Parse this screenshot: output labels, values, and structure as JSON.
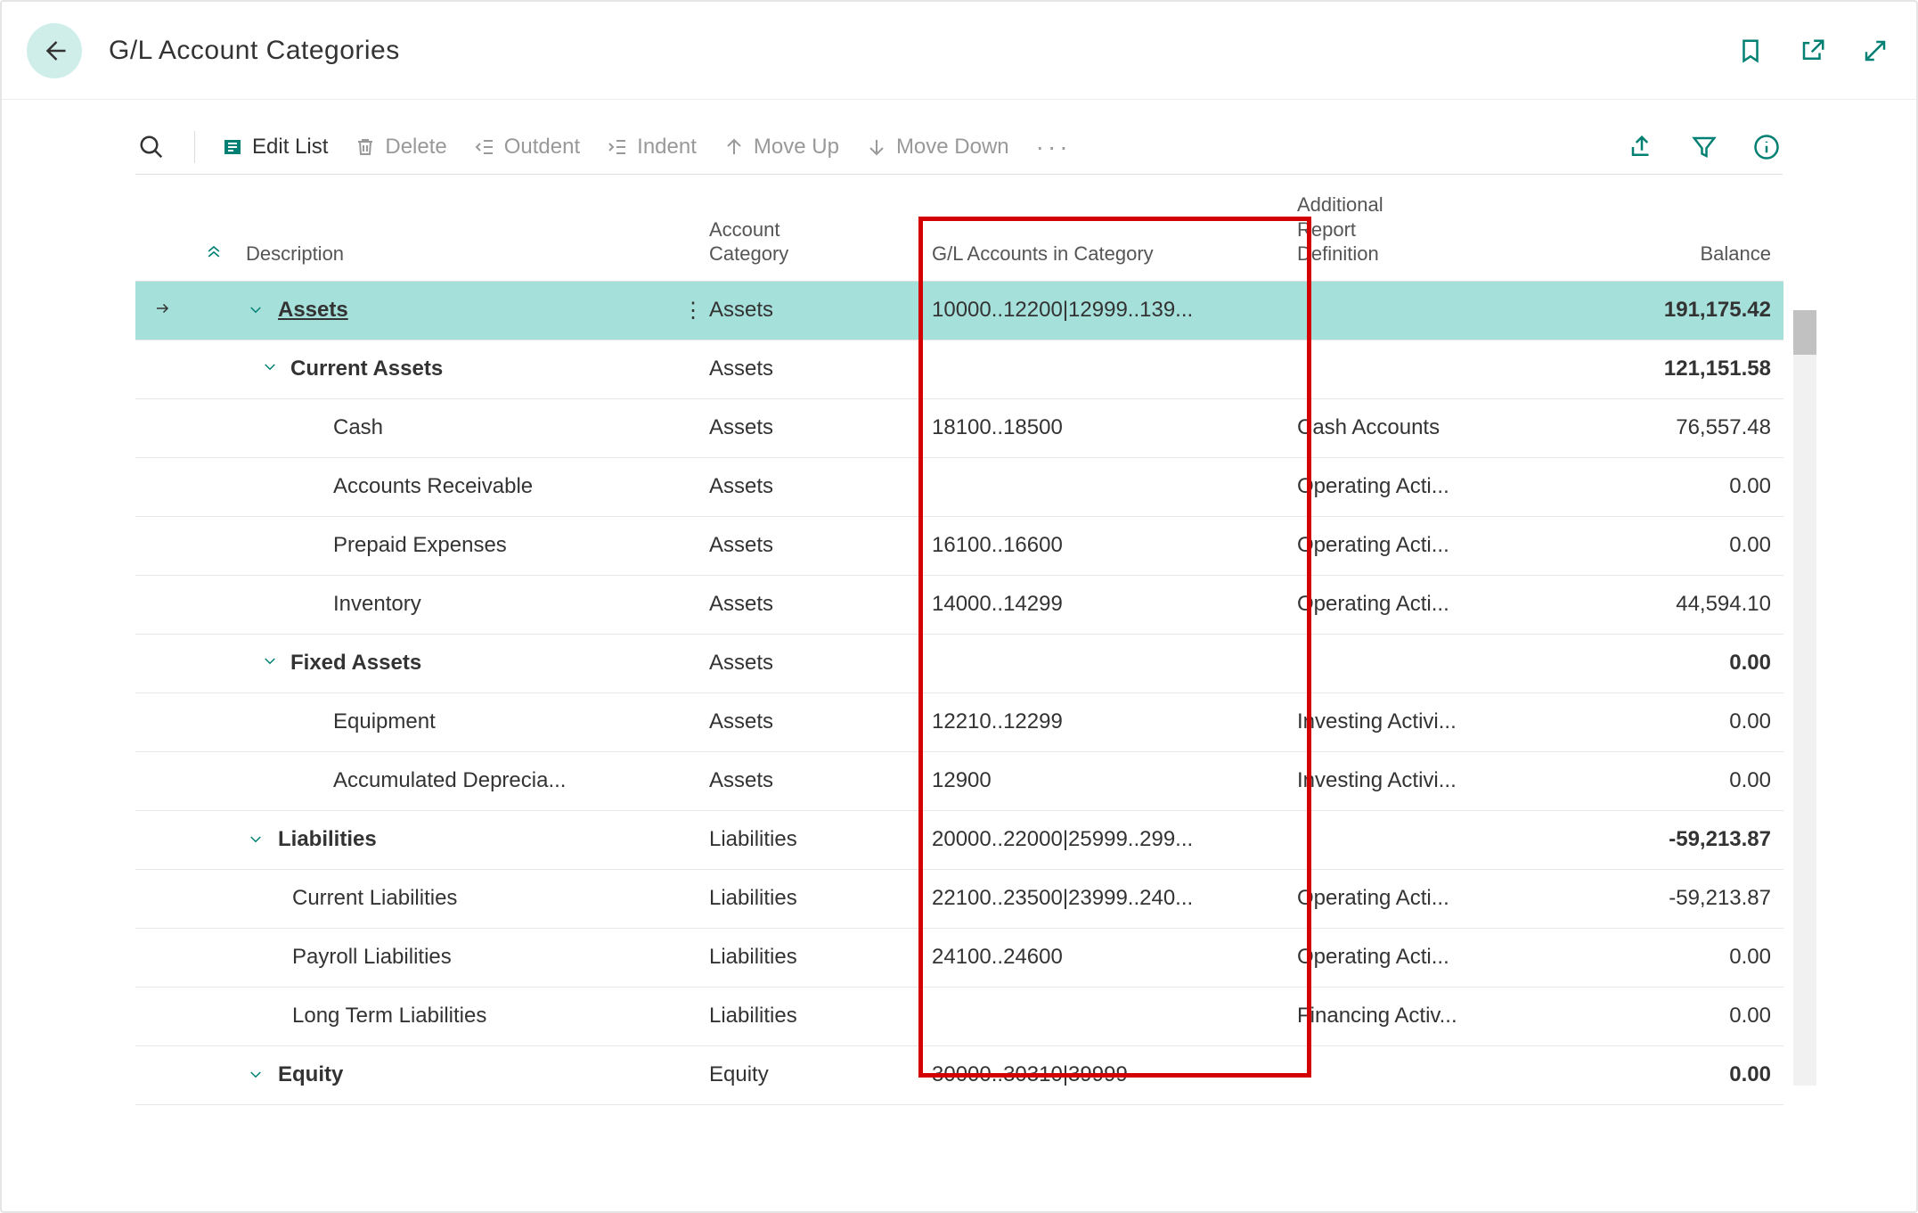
{
  "page": {
    "title": "G/L Account Categories"
  },
  "toolbar": {
    "edit_list": "Edit List",
    "delete": "Delete",
    "outdent": "Outdent",
    "indent": "Indent",
    "move_up": "Move Up",
    "move_down": "Move Down"
  },
  "columns": {
    "description": "Description",
    "account_category": "Account\nCategory",
    "gl_accounts": "G/L Accounts in Category",
    "report_def": "Additional\nReport\nDefinition",
    "balance": "Balance"
  },
  "rows": [
    {
      "indent": 0,
      "expand": true,
      "bold": true,
      "underline": true,
      "selected": true,
      "arrow": true,
      "menu": true,
      "description": "Assets",
      "category": "Assets",
      "gl": "10000..12200|12999..139...",
      "report": "",
      "balance": "191,175.42"
    },
    {
      "indent": 1,
      "expand": true,
      "bold": true,
      "description": "Current Assets",
      "category": "Assets",
      "gl": "",
      "report": "",
      "balance": "121,151.58"
    },
    {
      "indent": 2,
      "description": "Cash",
      "category": "Assets",
      "gl": "18100..18500",
      "report": "Cash Accounts",
      "balance": "76,557.48"
    },
    {
      "indent": 2,
      "description": "Accounts Receivable",
      "category": "Assets",
      "gl": "",
      "report": "Operating Acti...",
      "balance": "0.00"
    },
    {
      "indent": 2,
      "description": "Prepaid Expenses",
      "category": "Assets",
      "gl": "16100..16600",
      "report": "Operating Acti...",
      "balance": "0.00"
    },
    {
      "indent": 2,
      "description": "Inventory",
      "category": "Assets",
      "gl": "14000..14299",
      "report": "Operating Acti...",
      "balance": "44,594.10"
    },
    {
      "indent": 1,
      "expand": true,
      "bold": true,
      "description": "Fixed Assets",
      "category": "Assets",
      "gl": "",
      "report": "",
      "balance": "0.00"
    },
    {
      "indent": 2,
      "description": "Equipment",
      "category": "Assets",
      "gl": "12210..12299",
      "report": "Investing Activi...",
      "balance": "0.00"
    },
    {
      "indent": 2,
      "description": "Accumulated Deprecia...",
      "category": "Assets",
      "gl": "12900",
      "report": "Investing Activi...",
      "balance": "0.00"
    },
    {
      "indent": 0,
      "expand": true,
      "bold": true,
      "description": "Liabilities",
      "category": "Liabilities",
      "gl": "20000..22000|25999..299...",
      "report": "",
      "balance": "-59,213.87"
    },
    {
      "indent": 1,
      "description": "Current Liabilities",
      "category": "Liabilities",
      "gl": "22100..23500|23999..240...",
      "report": "Operating Acti...",
      "balance": "-59,213.87"
    },
    {
      "indent": 1,
      "description": "Payroll Liabilities",
      "category": "Liabilities",
      "gl": "24100..24600",
      "report": "Operating Acti...",
      "balance": "0.00"
    },
    {
      "indent": 1,
      "description": "Long Term Liabilities",
      "category": "Liabilities",
      "gl": "",
      "report": "Financing Activ...",
      "balance": "0.00"
    },
    {
      "indent": 0,
      "expand": true,
      "bold": true,
      "description": "Equity",
      "category": "Equity",
      "gl": "30000..30310|39999",
      "report": "",
      "balance": "0.00"
    }
  ]
}
